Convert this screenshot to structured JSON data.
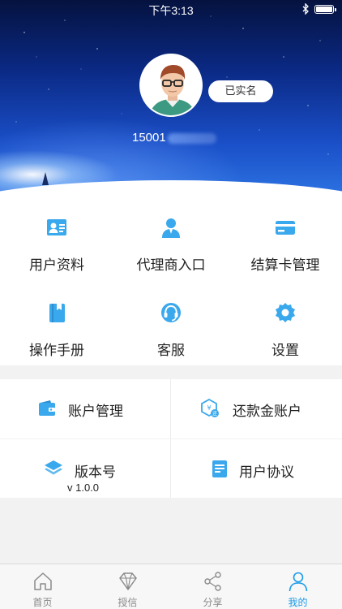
{
  "status_bar": {
    "time": "下午3:13",
    "icons": [
      "bluetooth-icon",
      "battery-icon"
    ]
  },
  "profile": {
    "verified_label": "已实名",
    "phone_visible": "15001",
    "avatar_icon": "user-avatar-icon"
  },
  "grid_menu": {
    "items": [
      {
        "label": "用户资料",
        "icon": "id-card-icon"
      },
      {
        "label": "代理商入口",
        "icon": "agent-person-icon"
      },
      {
        "label": "结算卡管理",
        "icon": "bank-card-icon"
      },
      {
        "label": "操作手册",
        "icon": "manual-book-icon"
      },
      {
        "label": "客服",
        "icon": "headset-icon"
      },
      {
        "label": "设置",
        "icon": "gear-icon"
      }
    ]
  },
  "account_rows": {
    "account_management": {
      "label": "账户管理",
      "icon": "wallet-icon"
    },
    "repayment_account": {
      "label": "还款金账户",
      "icon": "repay-coin-icon"
    },
    "version": {
      "label": "版本号",
      "value": "v 1.0.0",
      "icon": "layers-icon"
    },
    "user_agreement": {
      "label": "用户协议",
      "icon": "document-icon"
    }
  },
  "tab_bar": {
    "tabs": [
      {
        "label": "首页",
        "icon": "home-icon",
        "active": false
      },
      {
        "label": "授信",
        "icon": "diamond-icon",
        "active": false
      },
      {
        "label": "分享",
        "icon": "share-icon",
        "active": false
      },
      {
        "label": "我的",
        "icon": "person-icon",
        "active": true
      }
    ]
  },
  "colors": {
    "accent": "#1a9be8",
    "icon_blue": "#3aa8ec",
    "hero_dark": "#05123f",
    "hero_light": "#2f78e6"
  }
}
